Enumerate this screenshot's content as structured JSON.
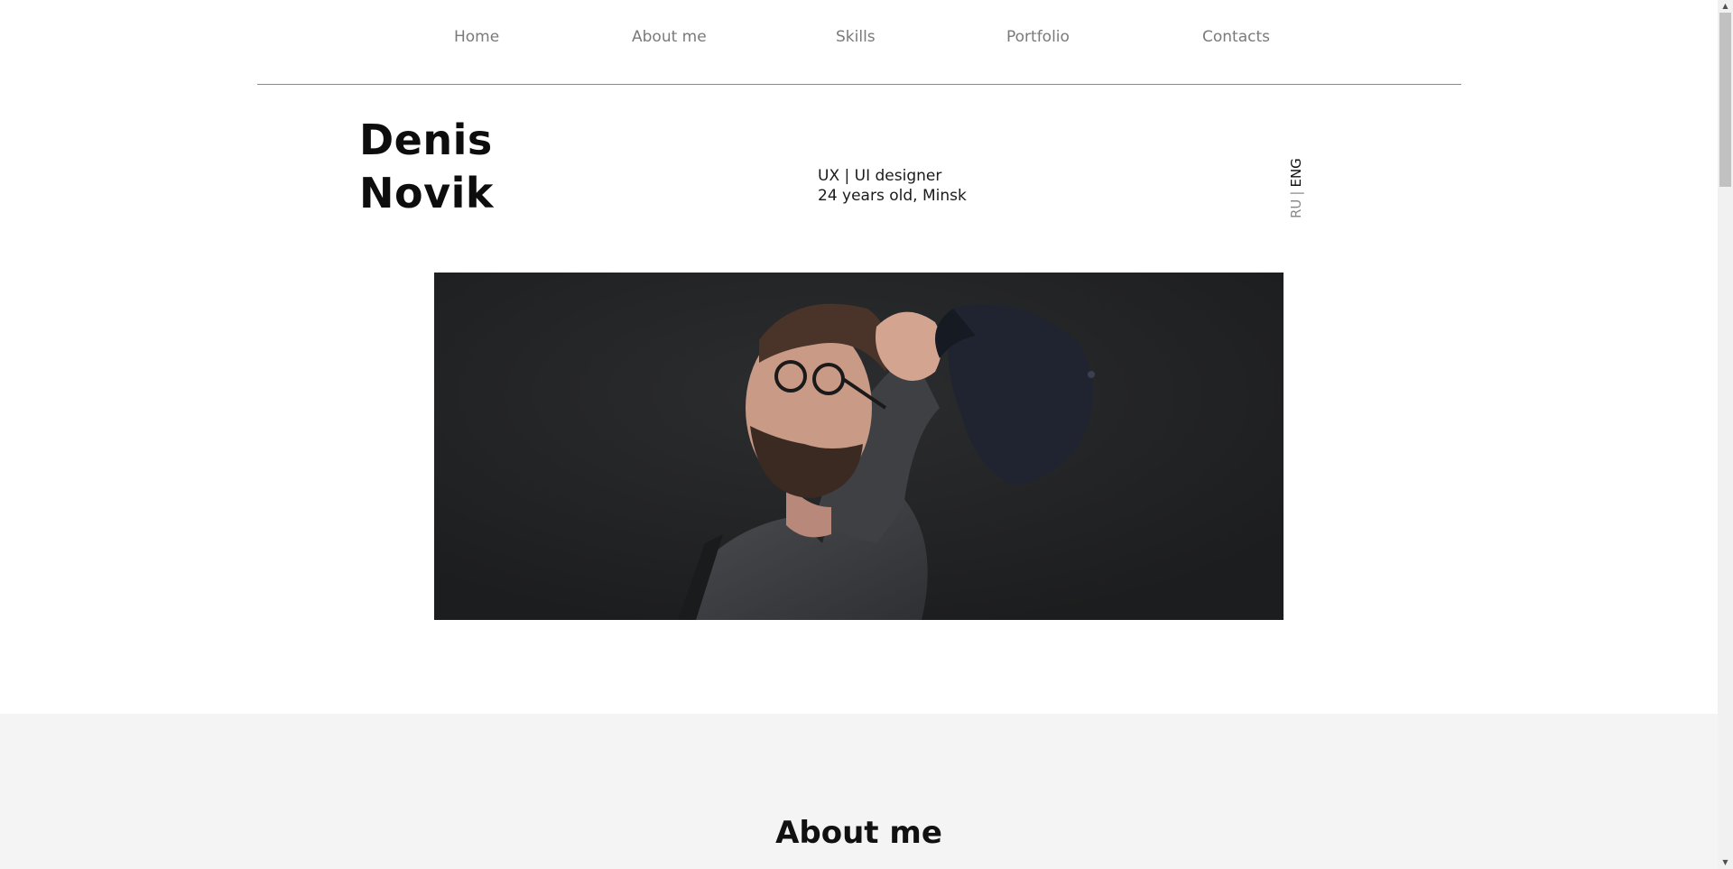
{
  "nav": {
    "items": [
      {
        "label": "Home"
      },
      {
        "label": "About me"
      },
      {
        "label": "Skills"
      },
      {
        "label": "Portfolio"
      },
      {
        "label": "Contacts"
      }
    ]
  },
  "hero": {
    "first_name": "Denis",
    "last_name": "Novik",
    "role": "UX | UI designer",
    "details": "24 years old, Minsk"
  },
  "lang": {
    "ru": "RU",
    "separator": "|",
    "en": "ENG",
    "active": "ENG"
  },
  "about": {
    "title": "About me",
    "background": "#f4f4f4"
  },
  "colors": {
    "nav_text": "#7a7a7a",
    "divider": "#8a8a8a",
    "heading": "#0d0d0d"
  }
}
